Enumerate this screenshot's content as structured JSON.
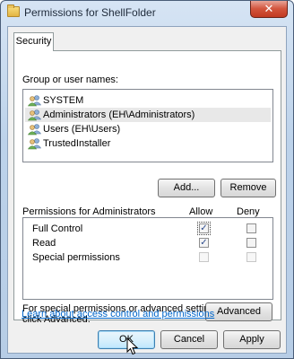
{
  "window": {
    "title": "Permissions for ShellFolder",
    "close_glyph": "✕"
  },
  "tabs": [
    {
      "label": "Security"
    }
  ],
  "group_list": {
    "label": "Group or user names:",
    "items": [
      {
        "name": "SYSTEM"
      },
      {
        "name": "Administrators (EH\\Administrators)"
      },
      {
        "name": "Users (EH\\Users)"
      },
      {
        "name": "TrustedInstaller"
      }
    ]
  },
  "buttons": {
    "add": "Add...",
    "remove": "Remove",
    "advanced": "Advanced",
    "ok": "OK",
    "cancel": "Cancel",
    "apply": "Apply"
  },
  "permissions": {
    "label": "Permissions for Administrators",
    "allow_header": "Allow",
    "deny_header": "Deny",
    "rows": [
      {
        "name": "Full Control",
        "allow": true,
        "deny": false
      },
      {
        "name": "Read",
        "allow": true,
        "deny": false
      },
      {
        "name": "Special permissions",
        "allow": false,
        "deny": false
      }
    ]
  },
  "advanced_note": {
    "line1": "For special permissions or advanced settings,",
    "line2": "click Advanced."
  },
  "help_link": "Learn about access control and permissions",
  "colors": {
    "link": "#0066cc",
    "check": "#2c4a8c",
    "titlebar": "#bcd2ea",
    "close": "#c23a22"
  }
}
